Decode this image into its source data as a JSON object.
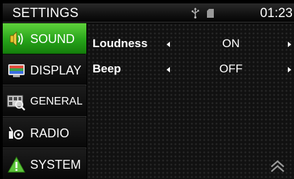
{
  "statusbar": {
    "title": "SETTINGS",
    "time": "01:23",
    "icons": [
      "usb-icon",
      "sd-card-icon"
    ]
  },
  "sidebar": {
    "items": [
      {
        "label": "SOUND",
        "icon": "speaker-icon",
        "active": true
      },
      {
        "label": "DISPLAY",
        "icon": "display-icon",
        "active": false
      },
      {
        "label": "GENERAL",
        "icon": "general-icon",
        "active": false
      },
      {
        "label": "RADIO",
        "icon": "radio-icon",
        "active": false
      },
      {
        "label": "SYSTEM",
        "icon": "warning-icon",
        "active": false
      }
    ]
  },
  "settings": [
    {
      "name": "Loudness",
      "value": "ON"
    },
    {
      "name": "Beep",
      "value": "OFF"
    }
  ],
  "colors": {
    "active": "#2faf1e",
    "background": "#000000",
    "text": "#ffffff"
  }
}
